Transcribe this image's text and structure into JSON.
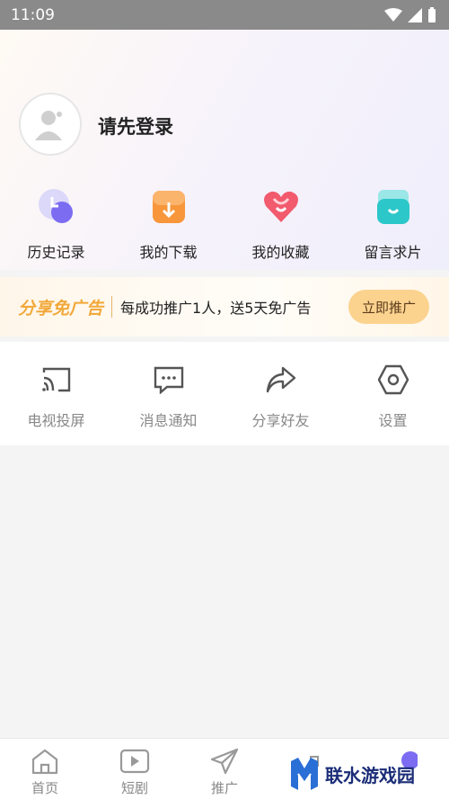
{
  "status_bar": {
    "time": "11:09"
  },
  "profile": {
    "login_text": "请先登录"
  },
  "quick_actions": [
    {
      "label": "历史记录",
      "icon": "history-icon",
      "color": "#7b6cf2"
    },
    {
      "label": "我的下载",
      "icon": "download-icon",
      "color": "#f7963a"
    },
    {
      "label": "我的收藏",
      "icon": "favorite-heart-icon",
      "color": "#f25a6e"
    },
    {
      "label": "留言求片",
      "icon": "message-request-icon",
      "color": "#2cc7c9"
    }
  ],
  "promo": {
    "title": "分享免广告",
    "text": "每成功推广1人，送5天免广告",
    "button": "立即推广"
  },
  "tools": [
    {
      "label": "电视投屏",
      "icon": "cast-icon"
    },
    {
      "label": "消息通知",
      "icon": "message-icon"
    },
    {
      "label": "分享好友",
      "icon": "share-icon"
    },
    {
      "label": "设置",
      "icon": "settings-icon"
    }
  ],
  "tabbar": [
    {
      "label": "首页",
      "icon": "home-icon"
    },
    {
      "label": "短剧",
      "icon": "play-video-icon"
    },
    {
      "label": "推广",
      "icon": "send-icon"
    },
    {
      "label": "",
      "icon": "bag-icon"
    },
    {
      "label": "",
      "icon": "profile-icon"
    }
  ],
  "watermark": {
    "text": "联水游戏园"
  }
}
